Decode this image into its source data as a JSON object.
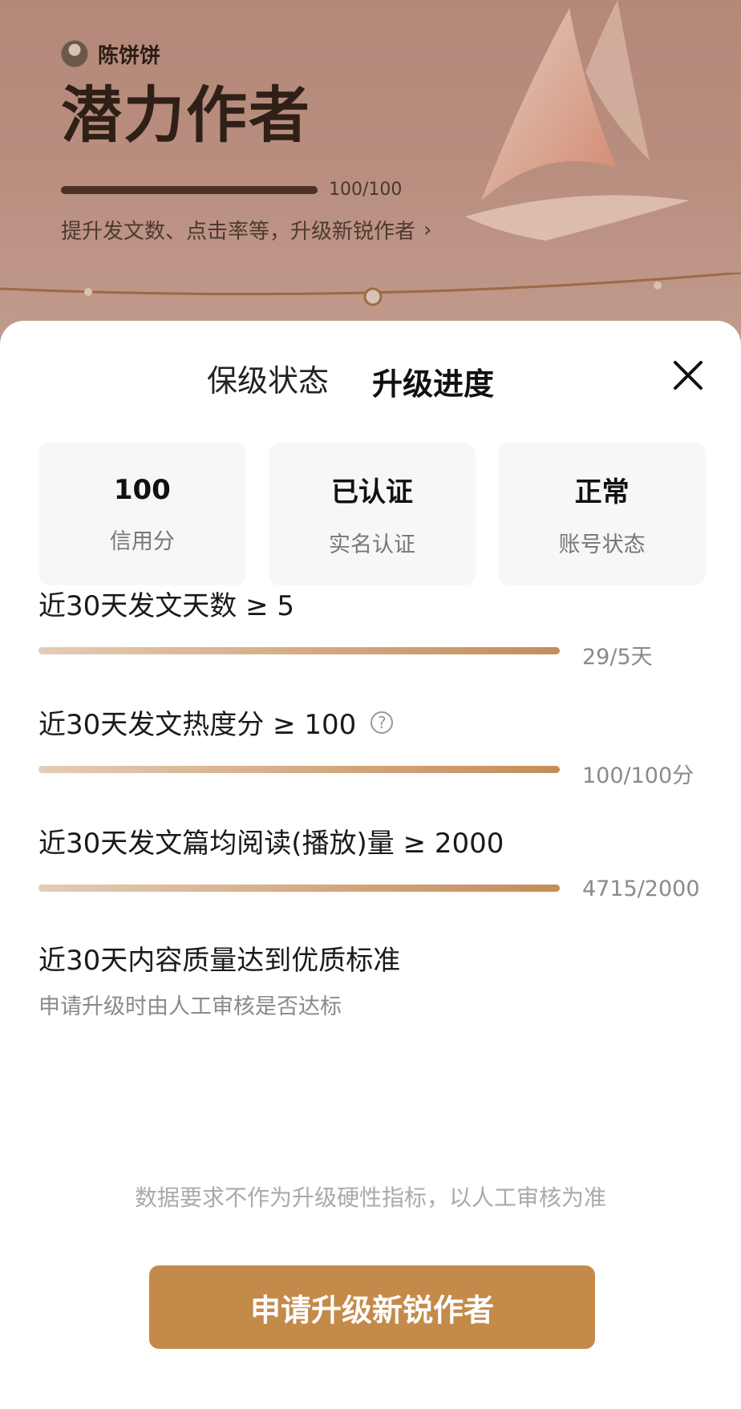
{
  "header": {
    "username": "陈饼饼",
    "level_title": "潜力作者",
    "level_progress_text": "100/100",
    "level_progress_fraction": 1.0,
    "hint": "提升发文数、点击率等，升级新锐作者"
  },
  "tabs": [
    {
      "label": "保级状态",
      "active": false
    },
    {
      "label": "升级进度",
      "active": true
    }
  ],
  "status_cards": [
    {
      "value": "100",
      "label": "信用分"
    },
    {
      "value": "已认证",
      "label": "实名认证"
    },
    {
      "value": "正常",
      "label": "账号状态"
    }
  ],
  "requirements": [
    {
      "title": "近30天发文天数 ≥ 5",
      "progress_text": "29/5天",
      "progress_fraction": 1.0,
      "help": false
    },
    {
      "title": "近30天发文热度分 ≥ 100",
      "progress_text": "100/100分",
      "progress_fraction": 1.0,
      "help": true
    },
    {
      "title": "近30天发文篇均阅读(播放)量 ≥ 2000",
      "progress_text": "4715/2000",
      "progress_fraction": 1.0,
      "help": false
    },
    {
      "title": "近30天内容质量达到优质标准",
      "subtitle": "申请升级时由人工审核是否达标"
    }
  ],
  "disclaimer": "数据要求不作为升级硬性指标，以人工审核为准",
  "apply_button": "申请升级新锐作者",
  "icons": {
    "close": "close-icon",
    "help": "help-circle-icon",
    "chevron": "chevron-right-icon"
  },
  "colors": {
    "accent_button": "#c48a4a",
    "progress_gradient_end": "#c48d5a",
    "hero_background": "#b88d7e"
  }
}
